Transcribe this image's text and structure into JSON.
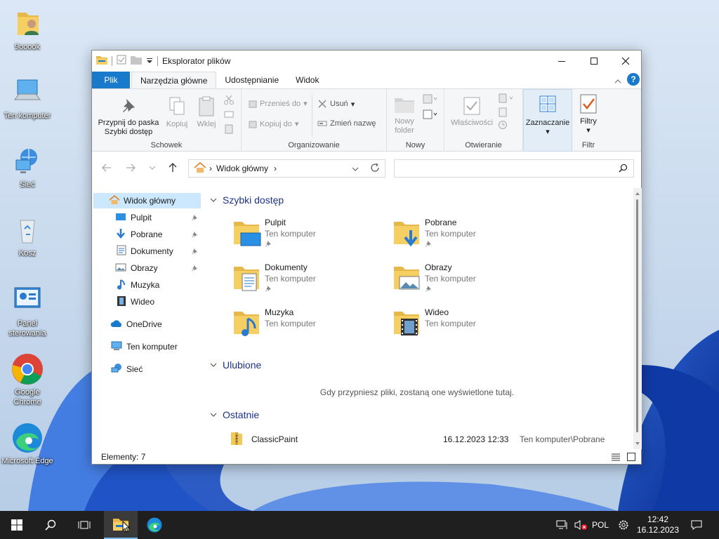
{
  "desktop": {
    "icons": [
      {
        "label": "9ooook"
      },
      {
        "label": "Ten komputer"
      },
      {
        "label": "Sieć"
      },
      {
        "label": "Kosz"
      },
      {
        "label": "Panel sterowania"
      },
      {
        "label": "Google Chrome"
      },
      {
        "label": "Microsoft Edge"
      }
    ]
  },
  "window": {
    "title": "Eksplorator plików",
    "tabs": [
      "Plik",
      "Narzędzia główne",
      "Udostępnianie",
      "Widok"
    ],
    "active_tab": "Narzędzia główne"
  },
  "ribbon": {
    "schowek": {
      "label": "Schowek",
      "pin": "Przypnij do paska Szybki dostęp",
      "copy": "Kopiuj",
      "paste": "Wklej"
    },
    "organizowanie": {
      "label": "Organizowanie",
      "move_to": "Przenieś do",
      "copy_to": "Kopiuj do",
      "delete": "Usuń",
      "rename": "Zmień nazwę"
    },
    "nowy": {
      "label": "Nowy",
      "new_folder": "Nowy folder"
    },
    "otwieranie": {
      "label": "Otwieranie",
      "properties": "Właściwości"
    },
    "zaznaczanie": {
      "label": "Zaznaczanie"
    },
    "filtr": {
      "label": "Filtr",
      "filters": "Filtry"
    }
  },
  "address": {
    "path": "Widok główny",
    "search_placeholder": ""
  },
  "navpane": {
    "home": "Widok główny",
    "items": [
      {
        "label": "Pulpit",
        "pinned": true
      },
      {
        "label": "Pobrane",
        "pinned": true
      },
      {
        "label": "Dokumenty",
        "pinned": true
      },
      {
        "label": "Obrazy",
        "pinned": true
      },
      {
        "label": "Muzyka",
        "pinned": false
      },
      {
        "label": "Wideo",
        "pinned": false
      }
    ],
    "onedrive": "OneDrive",
    "this_pc": "Ten komputer",
    "network": "Sieć"
  },
  "content": {
    "quick_access": {
      "title": "Szybki dostęp",
      "items": [
        {
          "name": "Pulpit",
          "location": "Ten komputer"
        },
        {
          "name": "Pobrane",
          "location": "Ten komputer"
        },
        {
          "name": "Dokumenty",
          "location": "Ten komputer"
        },
        {
          "name": "Obrazy",
          "location": "Ten komputer"
        },
        {
          "name": "Muzyka",
          "location": "Ten komputer"
        },
        {
          "name": "Wideo",
          "location": "Ten komputer"
        }
      ]
    },
    "favorites": {
      "title": "Ulubione",
      "empty_text": "Gdy przypniesz pliki, zostaną one wyświetlone tutaj."
    },
    "recent": {
      "title": "Ostatnie",
      "items": [
        {
          "name": "ClassicPaint",
          "date": "16.12.2023 12:33",
          "location": "Ten komputer\\Pobrane"
        }
      ]
    }
  },
  "status": {
    "count": "Elementy: 7"
  },
  "taskbar": {
    "language": "POL",
    "time": "12:42",
    "date": "16.12.2023"
  },
  "colors": {
    "accent": "#1979ca",
    "selection": "#cce8ff",
    "section_title": "#1e3287",
    "taskbar": "#1f1f1f"
  }
}
